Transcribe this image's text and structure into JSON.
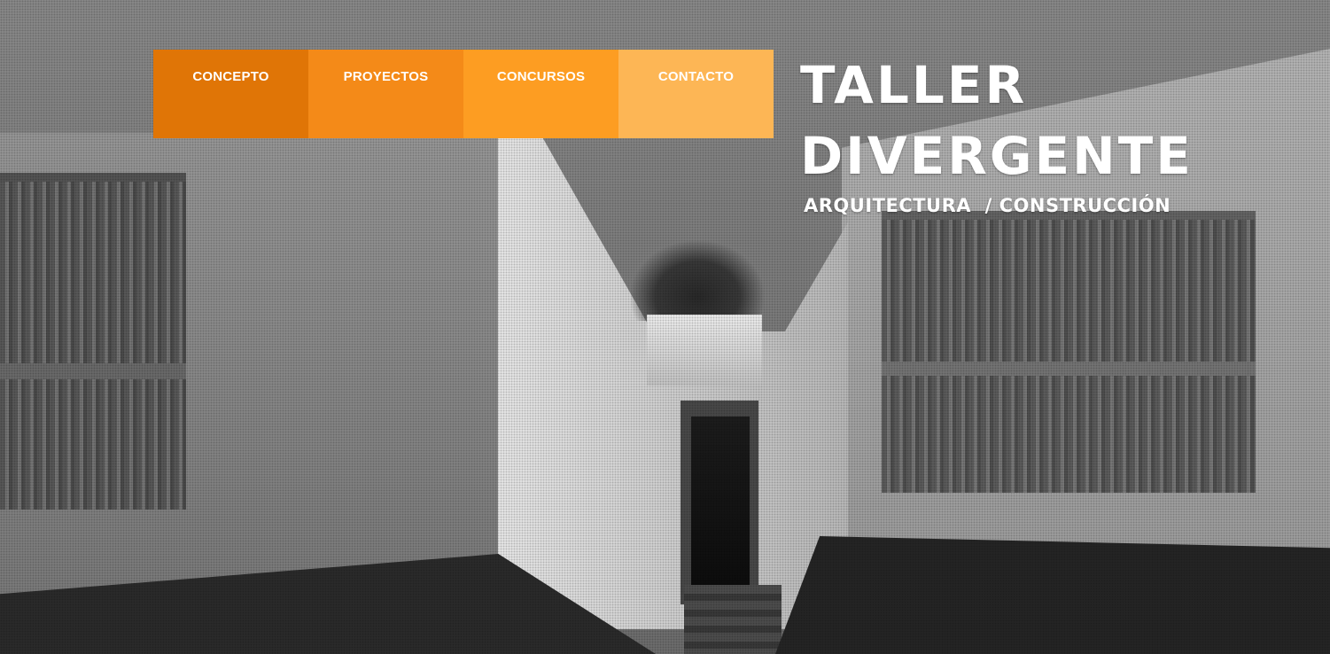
{
  "nav": {
    "items": [
      {
        "label": "CONCEPTO",
        "color": "#e07506"
      },
      {
        "label": "PROYECTOS",
        "color": "#f48a18"
      },
      {
        "label": "CONCURSOS",
        "color": "#fd9d22"
      },
      {
        "label": "CONTACTO",
        "color": "#fdb655"
      }
    ]
  },
  "brand": {
    "line1": "TALLER",
    "line2": "DIVERGENTE",
    "tagline": "ARQUITECTURA  / CONSTRUCCIÓN"
  },
  "hero": {
    "description_icon": "building-photo"
  }
}
